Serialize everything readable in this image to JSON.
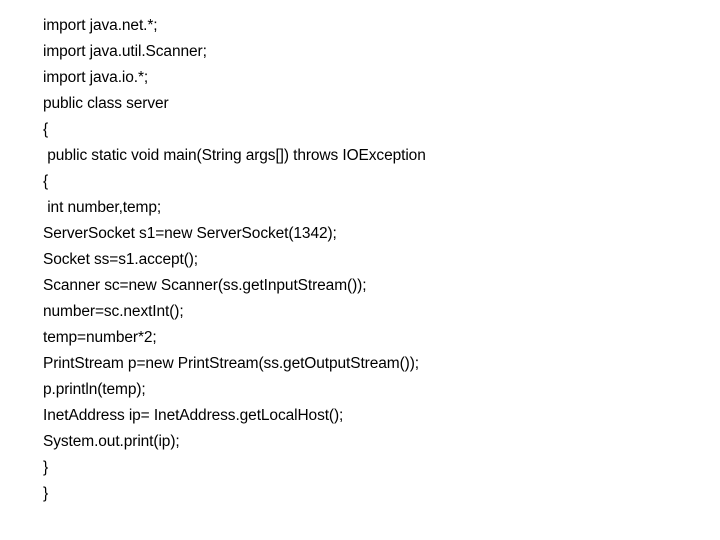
{
  "document": {
    "lines": [
      "import java.net.*;",
      "import java.util.Scanner;",
      "import java.io.*;",
      "public class server",
      "{",
      " public static void main(String args[]) throws IOException",
      "{",
      " int number,temp;",
      "ServerSocket s1=new ServerSocket(1342);",
      "Socket ss=s1.accept();",
      "Scanner sc=new Scanner(ss.getInputStream());",
      "number=sc.nextInt();",
      "temp=number*2;",
      "PrintStream p=new PrintStream(ss.getOutputStream());",
      "p.println(temp);",
      "InetAddress ip= InetAddress.getLocalHost();",
      "System.out.print(ip);",
      "}",
      "}"
    ]
  }
}
